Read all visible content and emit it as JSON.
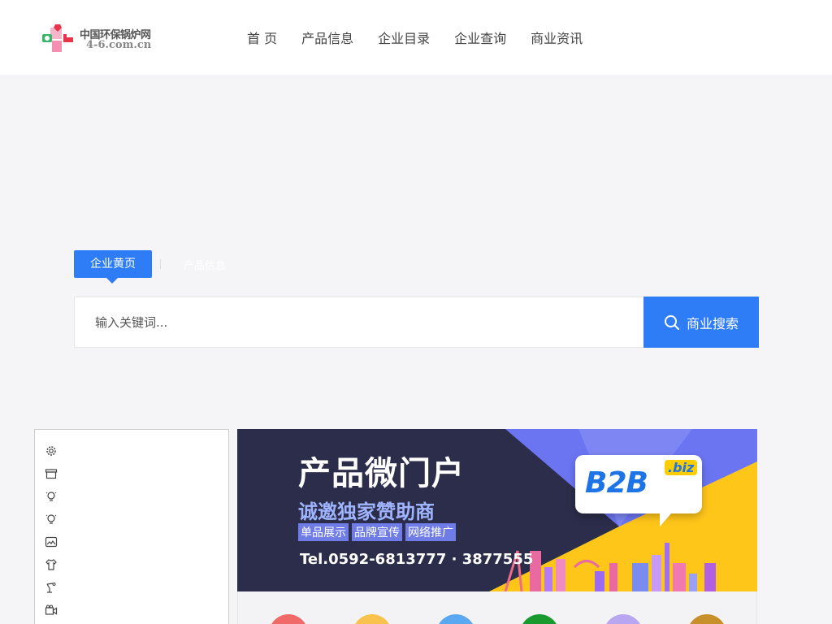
{
  "header": {
    "logo": {
      "title": "中国环保锅炉网",
      "domain": "4-6.com.cn"
    },
    "nav": [
      {
        "label": "首 页"
      },
      {
        "label": "产品信息"
      },
      {
        "label": "企业目录"
      },
      {
        "label": "企业查询"
      },
      {
        "label": "商业资讯"
      }
    ]
  },
  "search": {
    "tabs": [
      {
        "label": "企业黄页",
        "active": true
      },
      {
        "label": "产品信息",
        "active": false
      }
    ],
    "placeholder": "输入关键词...",
    "button_label": "商业搜索",
    "accent": "#2f7df6"
  },
  "categories": {
    "icons": [
      "gear-icon",
      "archive-icon",
      "lightbulb-icon",
      "lightbulb-icon",
      "image-icon",
      "shirt-icon",
      "robot-arm-icon",
      "camera-icon"
    ]
  },
  "banner": {
    "title": "产品微门户",
    "subtitle": "诚邀独家赞助商",
    "tags": [
      "单品展示",
      "品牌宣传",
      "网络推广"
    ],
    "tel": "Tel.0592-6813777 · 3877555",
    "badge_main": "B2B",
    "badge_suffix": ".biz"
  },
  "service_icons": {
    "colors": [
      "#f06a6a",
      "#f9c24c",
      "#5aa8f0",
      "#1a9a2e",
      "#b9a6f0",
      "#c8902a"
    ]
  }
}
